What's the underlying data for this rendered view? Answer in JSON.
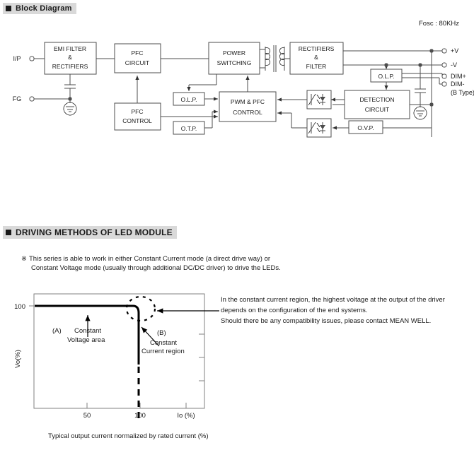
{
  "sections": {
    "block_diagram": {
      "title": "Block Diagram"
    },
    "driving_methods": {
      "title": "DRIVING METHODS OF LED MODULE"
    }
  },
  "block_diagram": {
    "fosc_label": "Fosc : 80KHz",
    "terminals_left": [
      {
        "name": "input-terminal",
        "label": "I/P"
      },
      {
        "name": "fg-terminal",
        "label": "FG"
      }
    ],
    "terminals_right": [
      {
        "name": "plus-v-terminal",
        "label": "+V"
      },
      {
        "name": "minus-v-terminal",
        "label": "-V"
      },
      {
        "name": "dim-plus-terminal",
        "label": "DIM+"
      },
      {
        "name": "dim-minus-terminal",
        "label": "DIM-"
      }
    ],
    "terminal_note": "(B Type)",
    "blocks": [
      {
        "id": "emi",
        "lines": [
          "EMI FILTER",
          "&",
          "RECTIFIERS"
        ]
      },
      {
        "id": "pfc_circuit",
        "lines": [
          "PFC",
          "CIRCUIT"
        ]
      },
      {
        "id": "power_switching",
        "lines": [
          "POWER",
          "SWITCHING"
        ]
      },
      {
        "id": "rectifiers_filter",
        "lines": [
          "RECTIFIERS",
          "&",
          "FILTER"
        ]
      },
      {
        "id": "pfc_control",
        "lines": [
          "PFC",
          "CONTROL"
        ]
      },
      {
        "id": "olp_left",
        "lines": [
          "O.L.P."
        ]
      },
      {
        "id": "otp",
        "lines": [
          "O.T.P."
        ]
      },
      {
        "id": "pwm_pfc_control",
        "lines": [
          "PWM & PFC",
          "CONTROL"
        ]
      },
      {
        "id": "olp_right",
        "lines": [
          "O.L.P."
        ]
      },
      {
        "id": "detection_circuit",
        "lines": [
          "DETECTION",
          "CIRCUIT"
        ]
      },
      {
        "id": "ovp",
        "lines": [
          "O.V.P."
        ]
      }
    ]
  },
  "driving_note": {
    "mark": "※",
    "line1": "This series is able to work in either Constant Current mode (a direct drive way) or",
    "line2": "Constant Voltage mode (usually through additional DC/DC driver) to drive the LEDs."
  },
  "right_text": {
    "line1": "In the constant current region, the highest voltage at the output of the driver",
    "line2": "depends on the configuration of the end systems.",
    "line3": "Should there be any compatibility issues, please contact MEAN WELL."
  },
  "chart_caption": "Typical output current normalized by rated current (%)",
  "chart_data": {
    "type": "line",
    "title": "",
    "xlabel": "Io (%)",
    "ylabel": "Vo(%)",
    "xlim": [
      0,
      130
    ],
    "ylim": [
      0,
      115
    ],
    "xticks": [
      50,
      100
    ],
    "xticklabels": [
      "50",
      "100"
    ],
    "yticks": [
      100
    ],
    "yticklabels": [
      "100"
    ],
    "grid": false,
    "legend": "none",
    "series": [
      {
        "name": "constant-voltage-then-current",
        "style": "solid",
        "x": [
          0,
          88,
          96,
          100,
          100
        ],
        "y": [
          100,
          100,
          99,
          92,
          40
        ]
      },
      {
        "name": "constant-current-extension",
        "style": "dashed",
        "x": [
          100,
          100
        ],
        "y": [
          40,
          0
        ]
      }
    ],
    "annotations": [
      {
        "name": "annotation-a",
        "label_line1": "(A)",
        "label_line2": "Constant",
        "label_line3": "Voltage area"
      },
      {
        "name": "annotation-b",
        "label_line1": "(B)",
        "label_line2": "Constant",
        "label_line3": "Current region"
      },
      {
        "name": "knee-highlight",
        "shape": "dashed-ellipse",
        "x": 100,
        "y": 100
      }
    ]
  },
  "colors": {
    "header_bg": "#d9d9d9",
    "line": "#4d4d4d",
    "text": "#1a1a1a",
    "curve": "#000000"
  }
}
